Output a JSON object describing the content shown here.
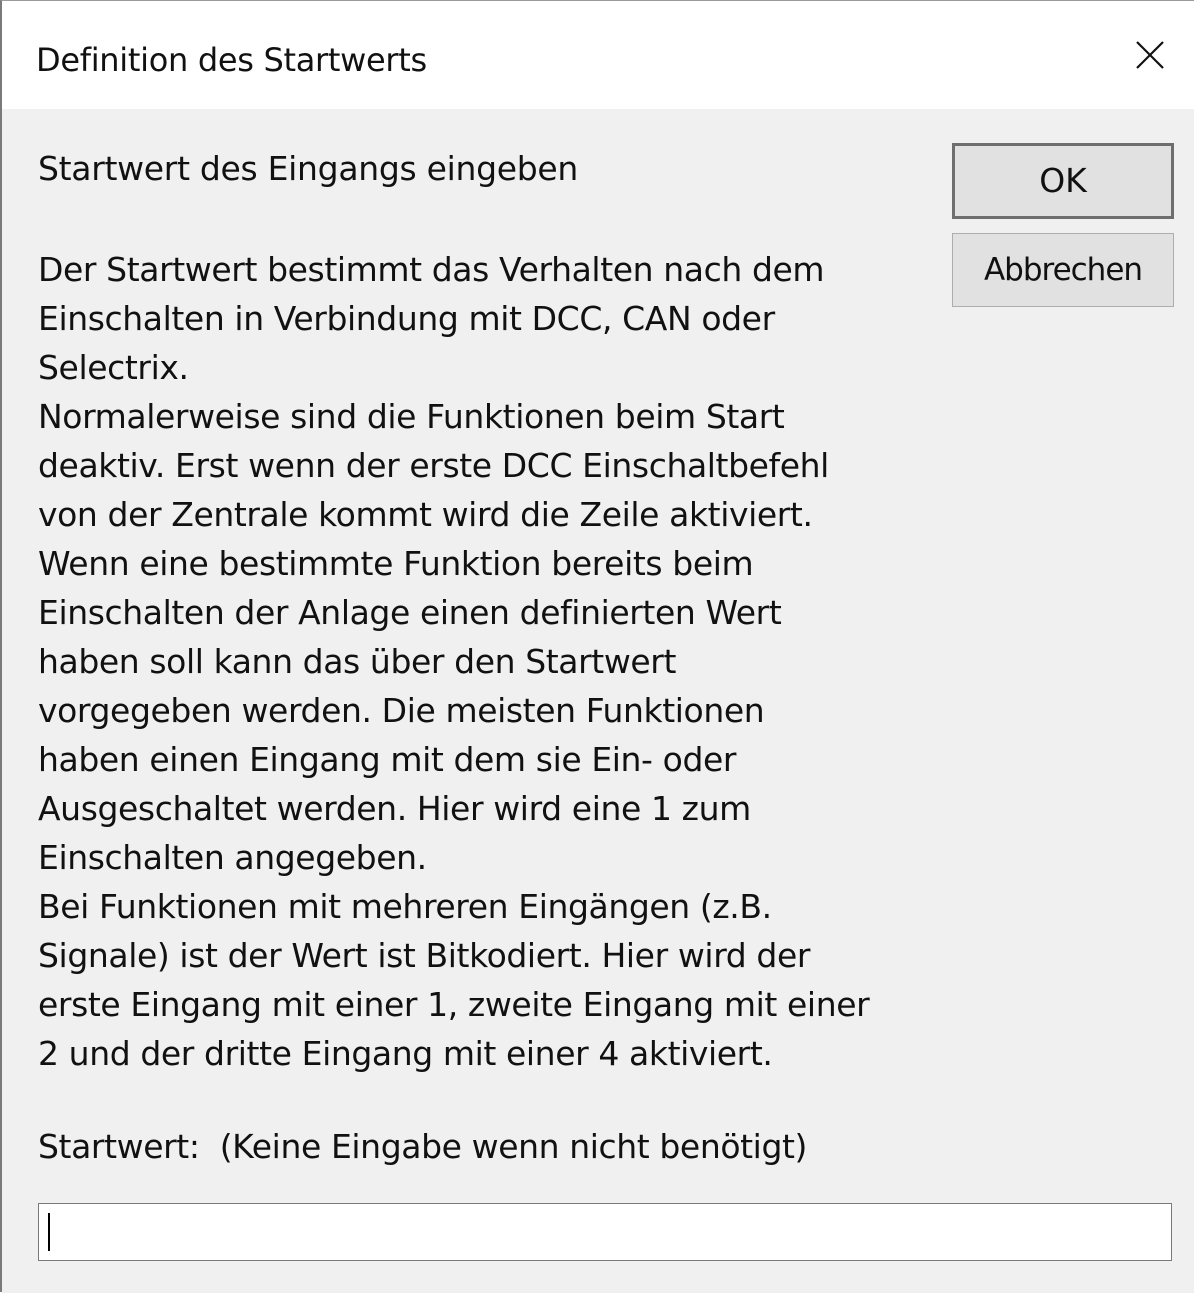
{
  "window": {
    "title": "Definition des Startwerts"
  },
  "dialog": {
    "heading": "Startwert des Eingangs eingeben",
    "description": "Der Startwert bestimmt das Verhalten nach dem\nEinschalten in Verbindung mit DCC, CAN oder\nSelectrix.\nNormalerweise sind die Funktionen beim Start\ndeaktiv. Erst wenn der erste DCC Einschaltbefehl\nvon der Zentrale kommt wird die Zeile aktiviert.\nWenn eine bestimmte Funktion bereits beim\nEinschalten der Anlage einen definierten Wert\nhaben soll kann das über den Startwert\nvorgegeben werden. Die meisten Funktionen\nhaben einen Eingang mit dem sie Ein- oder\nAusgeschaltet werden. Hier wird eine 1 zum\nEinschalten angegeben.\nBei Funktionen mit mehreren Eingängen (z.B.\nSignale) ist der Wert ist Bitkodiert. Hier wird der\nerste Eingang mit einer 1, zweite Eingang mit einer\n2 und der dritte Eingang mit einer 4 aktiviert.",
    "input_label": "Startwert:  (Keine Eingabe wenn nicht benötigt)",
    "input_value": ""
  },
  "buttons": {
    "ok_label": "OK",
    "cancel_label": "Abbrechen"
  },
  "icons": {
    "close": "close-icon"
  }
}
